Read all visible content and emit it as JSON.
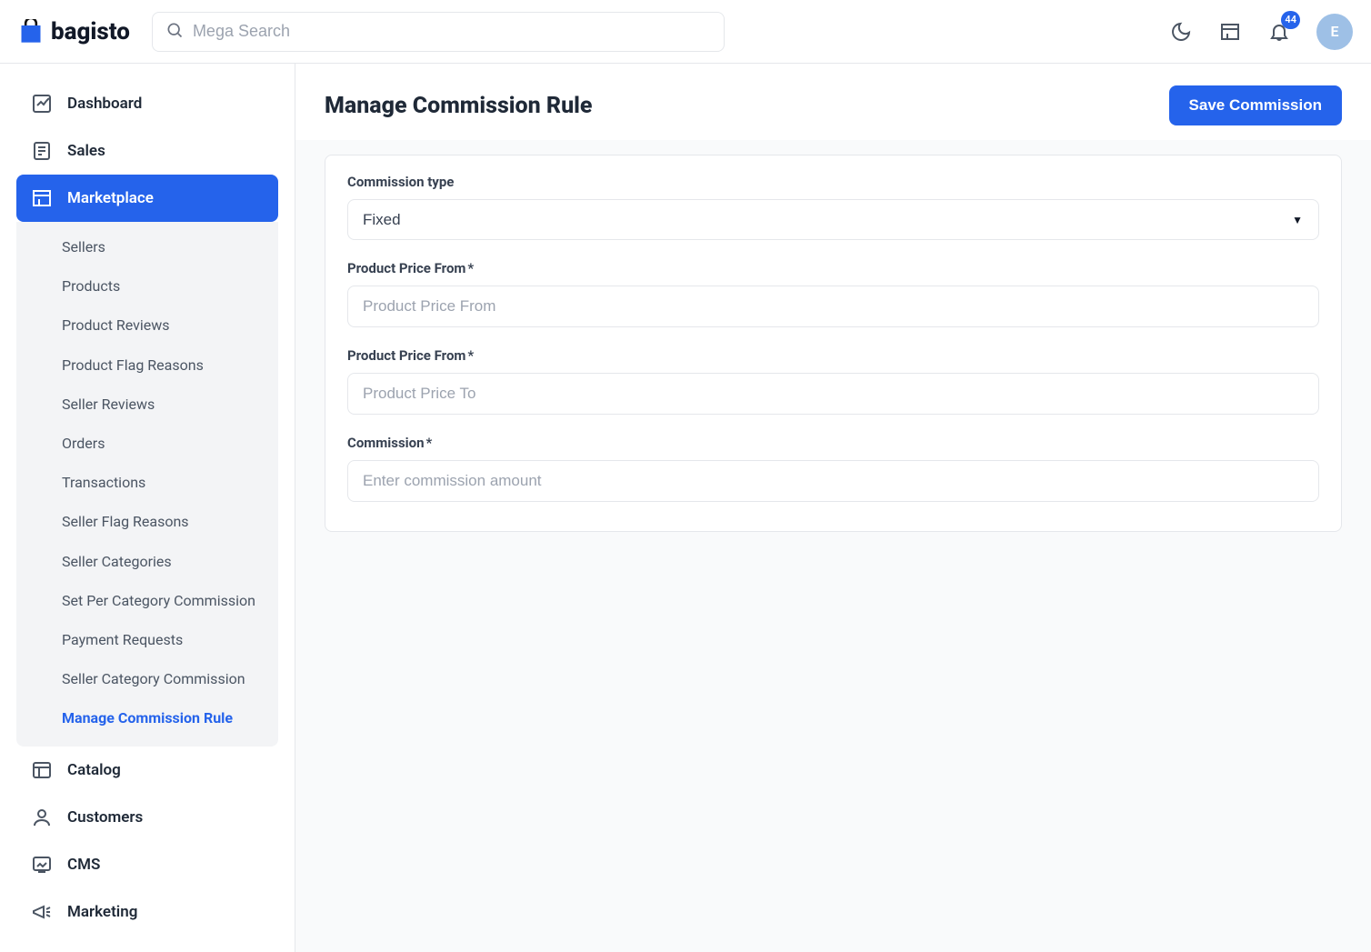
{
  "brand": "bagisto",
  "search": {
    "placeholder": "Mega Search"
  },
  "notifications": {
    "count": "44"
  },
  "avatar_initial": "E",
  "sidebar": {
    "items": [
      {
        "label": "Dashboard",
        "icon": "dashboard"
      },
      {
        "label": "Sales",
        "icon": "sales"
      },
      {
        "label": "Marketplace",
        "icon": "marketplace",
        "active": true
      },
      {
        "label": "Catalog",
        "icon": "catalog"
      },
      {
        "label": "Customers",
        "icon": "customers"
      },
      {
        "label": "CMS",
        "icon": "cms"
      },
      {
        "label": "Marketing",
        "icon": "marketing"
      }
    ],
    "marketplace_sub": [
      {
        "label": "Sellers"
      },
      {
        "label": "Products"
      },
      {
        "label": "Product Reviews"
      },
      {
        "label": "Product Flag Reasons"
      },
      {
        "label": "Seller Reviews"
      },
      {
        "label": "Orders"
      },
      {
        "label": "Transactions"
      },
      {
        "label": "Seller Flag Reasons"
      },
      {
        "label": "Seller Categories"
      },
      {
        "label": "Set Per Category Commission"
      },
      {
        "label": "Payment Requests"
      },
      {
        "label": "Seller Category Commission"
      },
      {
        "label": "Manage Commission Rule",
        "active": true
      }
    ]
  },
  "page": {
    "title": "Manage Commission Rule",
    "save_button": "Save Commission"
  },
  "form": {
    "commission_type": {
      "label": "Commission type",
      "value": "Fixed",
      "options": [
        "Fixed"
      ]
    },
    "price_from": {
      "label": "Product Price From",
      "required": "*",
      "placeholder": "Product Price From"
    },
    "price_to": {
      "label": "Product Price From",
      "required": "*",
      "placeholder": "Product Price To"
    },
    "commission": {
      "label": "Commission",
      "required": "*",
      "placeholder": "Enter commission amount"
    }
  }
}
